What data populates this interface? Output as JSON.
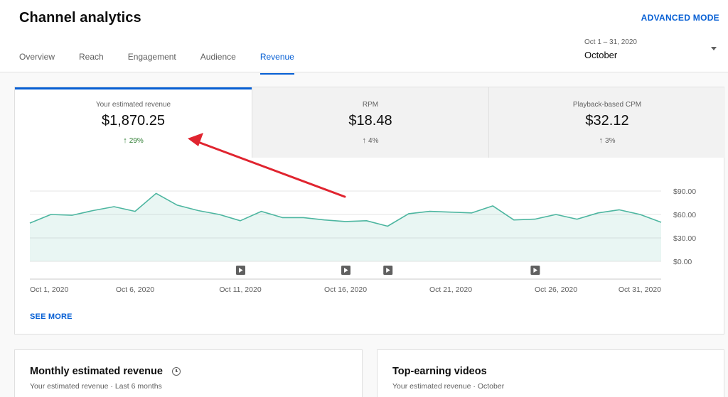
{
  "header": {
    "title": "Channel analytics",
    "advanced_mode": "ADVANCED MODE",
    "tabs": [
      "Overview",
      "Reach",
      "Engagement",
      "Audience",
      "Revenue"
    ],
    "active_tab": "Revenue",
    "date_range": {
      "range": "Oct 1 – 31, 2020",
      "label": "October",
      "icon": "dropdown-arrow-icon"
    }
  },
  "metrics": [
    {
      "label": "Your estimated revenue",
      "value": "$1,870.25",
      "change": "29%",
      "active": true
    },
    {
      "label": "RPM",
      "value": "$18.48",
      "change": "4%",
      "active": false
    },
    {
      "label": "Playback-based CPM",
      "value": "$32.12",
      "change": "3%",
      "active": false
    }
  ],
  "chart_data": {
    "type": "area",
    "x": [
      "2020-10-01",
      "2020-10-02",
      "2020-10-03",
      "2020-10-04",
      "2020-10-05",
      "2020-10-06",
      "2020-10-07",
      "2020-10-08",
      "2020-10-09",
      "2020-10-10",
      "2020-10-11",
      "2020-10-12",
      "2020-10-13",
      "2020-10-14",
      "2020-10-15",
      "2020-10-16",
      "2020-10-17",
      "2020-10-18",
      "2020-10-19",
      "2020-10-20",
      "2020-10-21",
      "2020-10-22",
      "2020-10-23",
      "2020-10-24",
      "2020-10-25",
      "2020-10-26",
      "2020-10-27",
      "2020-10-28",
      "2020-10-29",
      "2020-10-30",
      "2020-10-31"
    ],
    "series": [
      {
        "values": [
          49,
          60,
          59,
          65,
          70,
          64,
          87,
          72,
          65,
          60,
          52,
          64,
          56,
          56,
          53,
          51,
          52,
          45,
          61,
          64,
          63,
          62,
          71,
          53,
          54,
          60,
          54,
          62,
          66,
          60,
          50
        ],
        "color": "#4db6a0"
      }
    ],
    "x_tick_labels": [
      "Oct 1, 2020",
      "Oct 6, 2020",
      "Oct 11, 2020",
      "Oct 16, 2020",
      "Oct 21, 2020",
      "Oct 26, 2020",
      "Oct 31, 2020"
    ],
    "y_tick_labels": [
      "$0.00",
      "$30.00",
      "$60.00",
      "$90.00"
    ],
    "ylim": [
      0,
      90
    ],
    "grid": true,
    "video_markers_dates": [
      "2020-10-11",
      "2020-10-16",
      "2020-10-18",
      "2020-10-25"
    ]
  },
  "see_more": "SEE MORE",
  "panels": [
    {
      "title": "Monthly estimated revenue",
      "subtitle": "Your estimated revenue · Last 6 months",
      "icon": "clock-icon"
    },
    {
      "title": "Top-earning videos",
      "subtitle": "Your estimated revenue · October"
    }
  ],
  "annotation_color": "#e0242f"
}
